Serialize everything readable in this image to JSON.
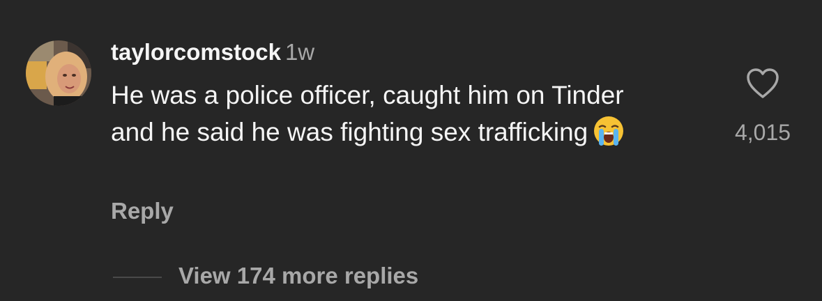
{
  "comment": {
    "username": "taylorcomstock",
    "timestamp": "1w",
    "text": "He was a police officer, caught him on Tinder and he said he was fighting sex trafficking",
    "emoji": "loudly-crying-face",
    "reply_label": "Reply",
    "like_icon": "heart-icon",
    "like_count": "4,015"
  },
  "replies": {
    "view_more_label": "View 174 more replies"
  },
  "colors": {
    "background": "#262626",
    "primary_text": "#f5f5f5",
    "secondary_text": "#a8a8a8",
    "divider": "#4a4a4a"
  }
}
